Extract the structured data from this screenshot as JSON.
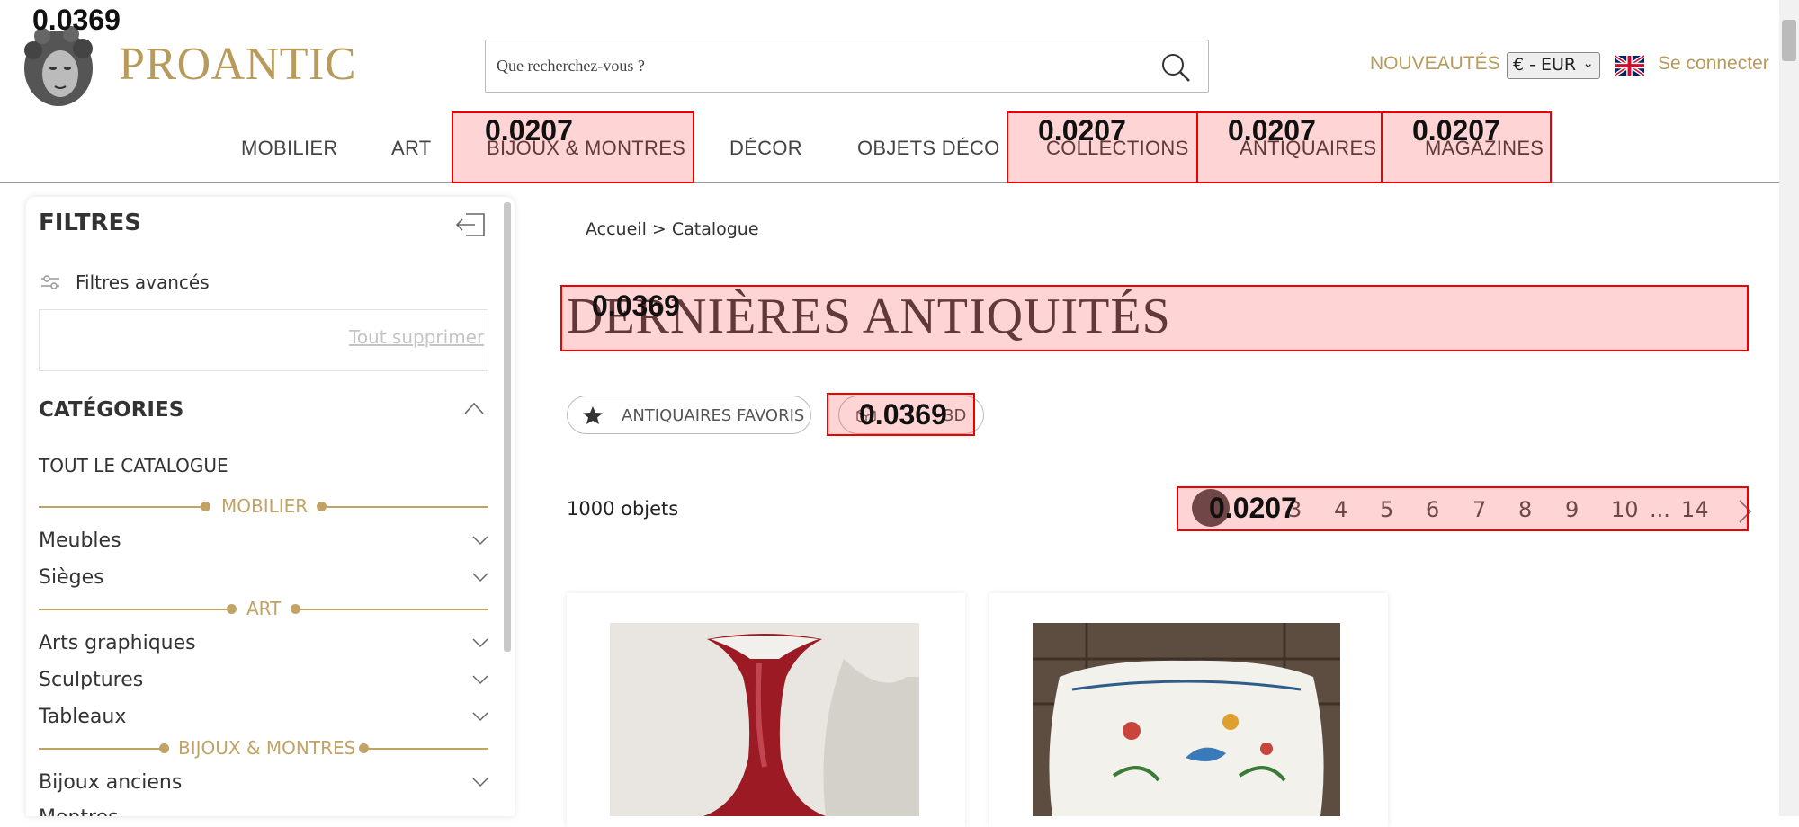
{
  "header": {
    "logo_text": "PROANTIC",
    "search_placeholder": "Que recherchez-vous ?",
    "nouveautes": "NOUVEAUTÉS",
    "currency": "€ - EUR",
    "login": "Se connecter"
  },
  "nav": [
    "MOBILIER",
    "ART",
    "BIJOUX & MONTRES",
    "DÉCOR",
    "OBJETS DÉCO",
    "COLLECTIONS",
    "ANTIQUAIRES",
    "MAGAZINES"
  ],
  "overlays": {
    "logo": "0.0369",
    "nav_bijoux": "0.0207",
    "nav_collections": "0.0207",
    "nav_antiquaires": "0.0207",
    "nav_magazines": "0.0207",
    "heading": "0.0369",
    "pill_3d": "0.0369",
    "pagination": "0.0207"
  },
  "sidebar": {
    "title": "FILTRES",
    "advanced": "Filtres avancés",
    "clear_all": "Tout supprimer",
    "categories_title": "CATÉGORIES",
    "all_catalogue": "TOUT LE CATALOGUE",
    "groups": {
      "mobilier": "MOBILIER",
      "art": "ART",
      "bijoux": "BIJOUX & MONTRES"
    },
    "items": {
      "meubles": "Meubles",
      "sieges": "Sièges",
      "arts_graphiques": "Arts graphiques",
      "sculptures": "Sculptures",
      "tableaux": "Tableaux",
      "bijoux_anciens": "Bijoux anciens",
      "montres": "Montres"
    }
  },
  "main": {
    "breadcrumb": "Accueil > Catalogue",
    "heading": "DERNIÈRES ANTIQUITÉS",
    "pill_favoris": "ANTIQUAIRES FAVORIS",
    "pill_3d": "3D",
    "count": "1000 objets",
    "pages": [
      "3",
      "4",
      "5",
      "6",
      "7",
      "8",
      "9",
      "10",
      "...",
      "14"
    ]
  },
  "colors": {
    "gold": "#c2a366",
    "overlay_red": "#e00000"
  }
}
